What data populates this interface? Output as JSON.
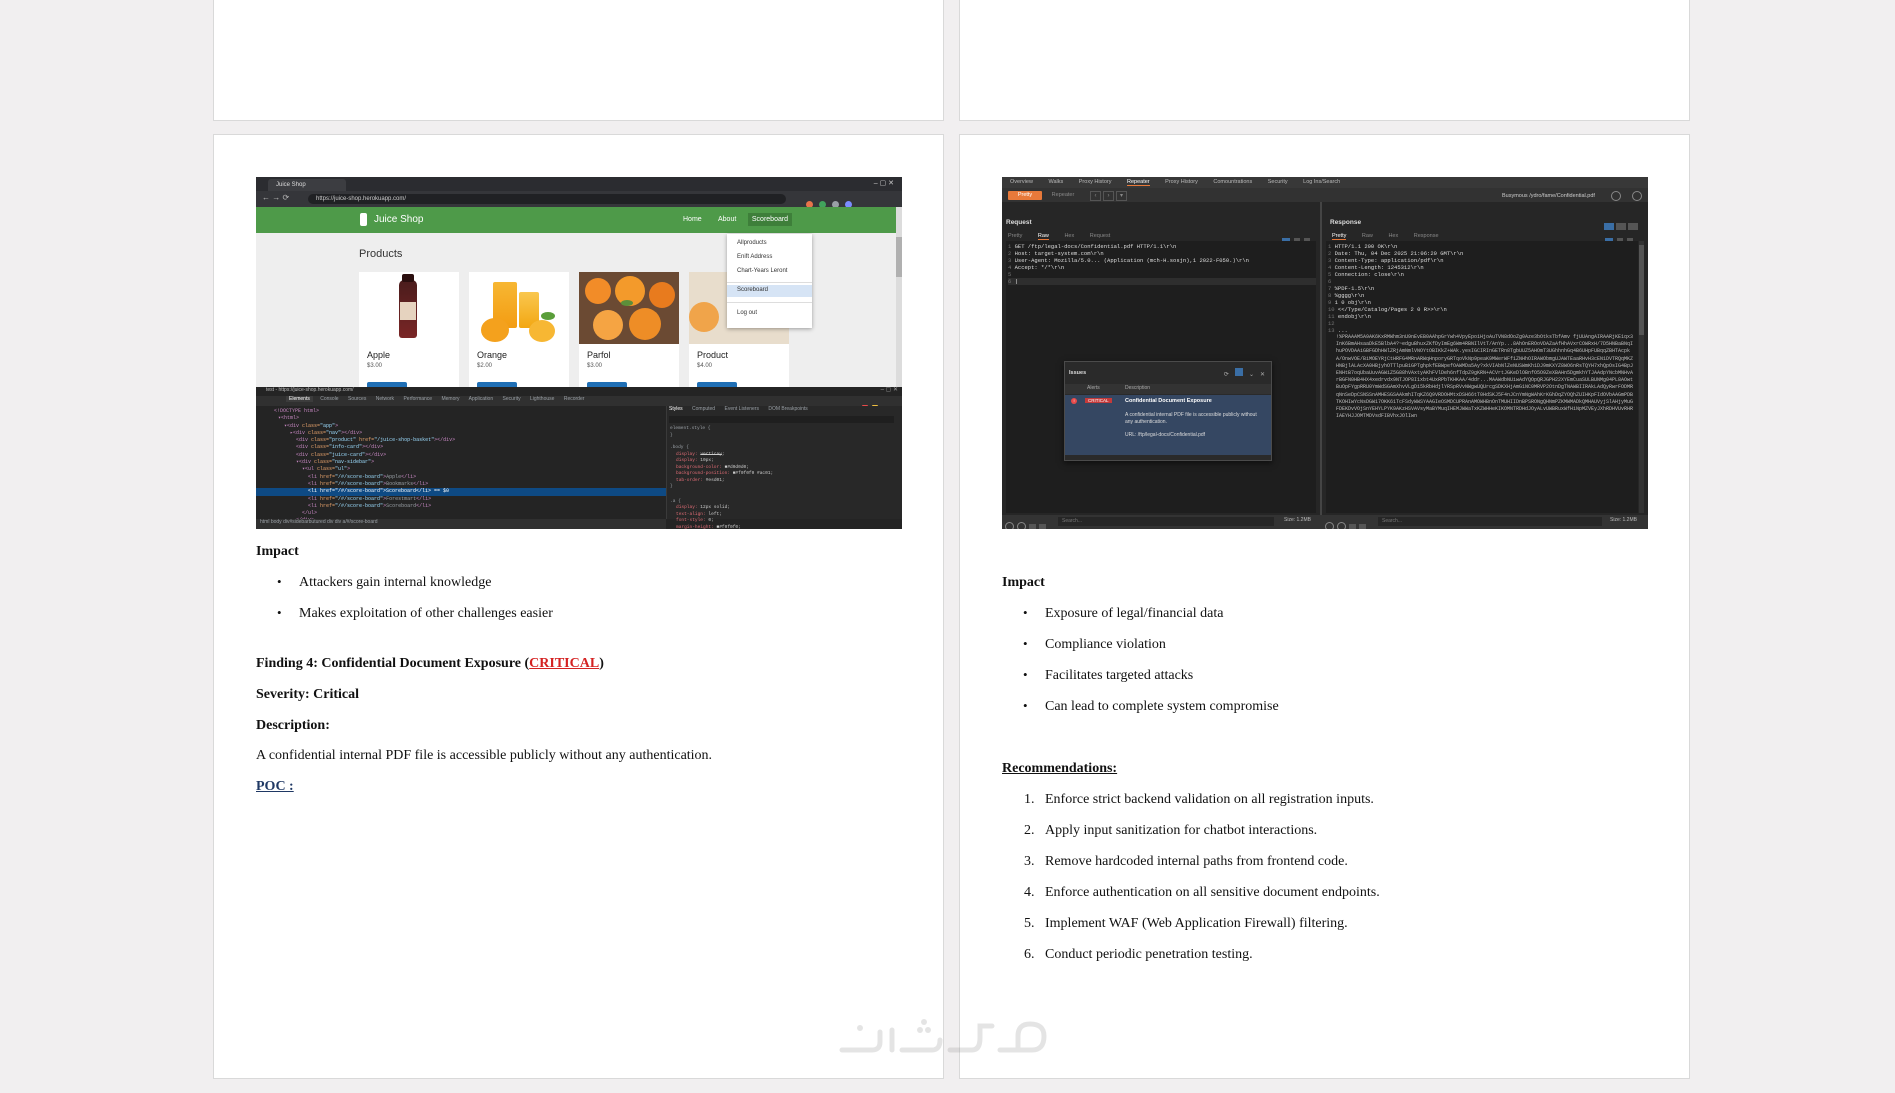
{
  "left_page": {
    "impact_heading": "Impact",
    "impact_items": [
      "Attackers gain internal knowledge",
      "Makes exploitation of other challenges easier"
    ],
    "finding_prefix": "Finding 4: Confidential Document Exposure (",
    "finding_severity_tag": "CRITICAL",
    "finding_suffix": ")",
    "severity_line": "Severity: Critical",
    "description_label": "Description:",
    "description_text": "A confidential internal PDF file is accessible publicly without any authentication.",
    "poc_label": "POC :"
  },
  "right_page": {
    "impact_heading": "Impact",
    "impact_items": [
      "Exposure of legal/financial data",
      "Compliance violation",
      "Facilitates targeted attacks",
      "Can lead to complete system compromise"
    ],
    "recommendations_heading": "Recommendations:",
    "recommendations": [
      {
        "num": "1.",
        "text": "Enforce strict backend validation on all registration inputs."
      },
      {
        "num": "2.",
        "text": "Apply input sanitization for chatbot interactions."
      },
      {
        "num": "3.",
        "text": "Remove hardcoded internal paths from frontend code."
      },
      {
        "num": "4.",
        "text": "Enforce authentication on all sensitive document endpoints."
      },
      {
        "num": "5.",
        "text": "Implement WAF (Web Application Firewall) filtering."
      },
      {
        "num": "6.",
        "text": "Conduct periodic penetration testing."
      }
    ]
  },
  "juice_shot": {
    "tab_title": "Juice Shop",
    "url": "https://juice-shop.herokuapp.com/",
    "brand": "Juice Shop",
    "nav": [
      "Home",
      "About",
      "Scoreboard"
    ],
    "section_title": "Products",
    "dropdown": [
      "Allproducts",
      "Enift Address",
      "Chart-Years Leront",
      "Scoreboard",
      "Log out"
    ],
    "products": [
      {
        "name": "Apple",
        "price": "$3.00"
      },
      {
        "name": "Orange",
        "price": "$2.00"
      },
      {
        "name": "Parfol",
        "price": "$3.00"
      },
      {
        "name": "Product",
        "price": "$4.00"
      }
    ],
    "devtools_url": "test - https://juice-shop.herokuapp.com/",
    "devtools_tabs": [
      "Elements",
      "Console",
      "Sources",
      "Network",
      "Performance",
      "Memory",
      "Application",
      "Security",
      "Lighthouse",
      "Recorder"
    ],
    "styles_tabs": [
      "Styles",
      "Computed",
      "Event Listeners",
      "DOM Breakpoints"
    ],
    "breadcrumb": "html  body  div#sidebarbutured  div  div  a/#/score-board"
  },
  "burp_shot": {
    "top_tabs": [
      "Overview",
      "Walks",
      "Proxy History",
      "Repeater",
      "Proxy History",
      "Comountrations",
      "Security",
      "Log Ins/Search"
    ],
    "send_label": "Pretty",
    "repeater_label": "Repeater",
    "target": "Busymous /ydro/fame/Confidential.pdf",
    "request_label": "Request",
    "response_label": "Response",
    "view_tabs": [
      "Pretty",
      "Raw",
      "Hex",
      "Request"
    ],
    "response_tabs": [
      "Pretty",
      "Raw",
      "Hex",
      "Response"
    ],
    "request_lines": [
      "GET /ftp/legal-docs/Confidential.pdf HTTP/1.1\\r\\n",
      "Host: target-system.com\\r\\n",
      "User-Agent: Mozilla/5.0... (Application (mch-H.sosjn),1 2022-F050.)\\r\\n",
      "Accept: */*\\r\\n"
    ],
    "response_lines": [
      "HTTP/1.1 200 OK\\r\\n",
      "Date: Thu, 04 Dec 2025 21:06:20 GMT\\r\\n",
      "Content-Type: application/pdf\\r\\n",
      "Content-Length: 1245312\\r\\n",
      "Connection: close\\r\\n",
      "",
      "%PDF-1.5\\r\\n",
      "%gggg\\r\\n",
      "1 0 obj\\r\\n",
      "<</Type/Catalog/Pages 2 0 R>>\\r\\n",
      "endobj\\r\\n"
    ],
    "issues_title": "Issues",
    "issues_cols": [
      "Alerts",
      "Description"
    ],
    "issue_severity": "CRITICAL",
    "issue_name": "Confidential Document Exposure",
    "issue_desc": "A confidential internal PDF file is accessible publicly without any authentication.",
    "issue_url": "URL: /ftp/legal-docs/Confidential.pdf",
    "search_placeholder": "Search...",
    "size_label": "Size: 1.2MB"
  }
}
